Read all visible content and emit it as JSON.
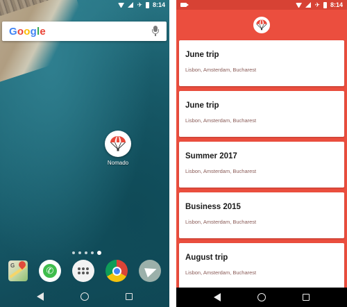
{
  "home_screen": {
    "status_bar": {
      "time": "8:14"
    },
    "search_bar": {
      "logo_text": "Google"
    },
    "app_shortcut": {
      "label": "Nomado",
      "icon": "parachute-icon"
    },
    "page_indicator": {
      "count": 5,
      "active_index": 4
    },
    "dock": [
      {
        "name": "maps",
        "icon": "maps-icon"
      },
      {
        "name": "whatsapp",
        "icon": "whatsapp-icon"
      },
      {
        "name": "app-drawer",
        "icon": "apps-grid-icon"
      },
      {
        "name": "chrome",
        "icon": "chrome-icon"
      },
      {
        "name": "telegram",
        "icon": "telegram-icon"
      }
    ],
    "nav_bar": [
      "back",
      "home",
      "recents"
    ]
  },
  "nomado_app": {
    "status_bar": {
      "time": "8:14"
    },
    "header": {
      "logo_icon": "parachute-icon"
    },
    "trips": [
      {
        "title": "June trip",
        "cities": "Lisbon, Amsterdam, Bucharest"
      },
      {
        "title": "June trip",
        "cities": "Lisbon, Amsterdam, Bucharest"
      },
      {
        "title": "Summer 2017",
        "cities": "Lisbon, Amsterdam, Bucharest"
      },
      {
        "title": "Business 2015",
        "cities": "Lisbon, Amsterdam, Bucharest"
      },
      {
        "title": "August trip",
        "cities": "Lisbon, Amsterdam, Bucharest"
      }
    ],
    "nav_bar": [
      "back",
      "home",
      "recents"
    ]
  },
  "colors": {
    "app_primary": "#eb4e3e",
    "app_status_bar": "#d74234",
    "card_background": "#ffffff",
    "cities_text": "#8a5b57"
  }
}
